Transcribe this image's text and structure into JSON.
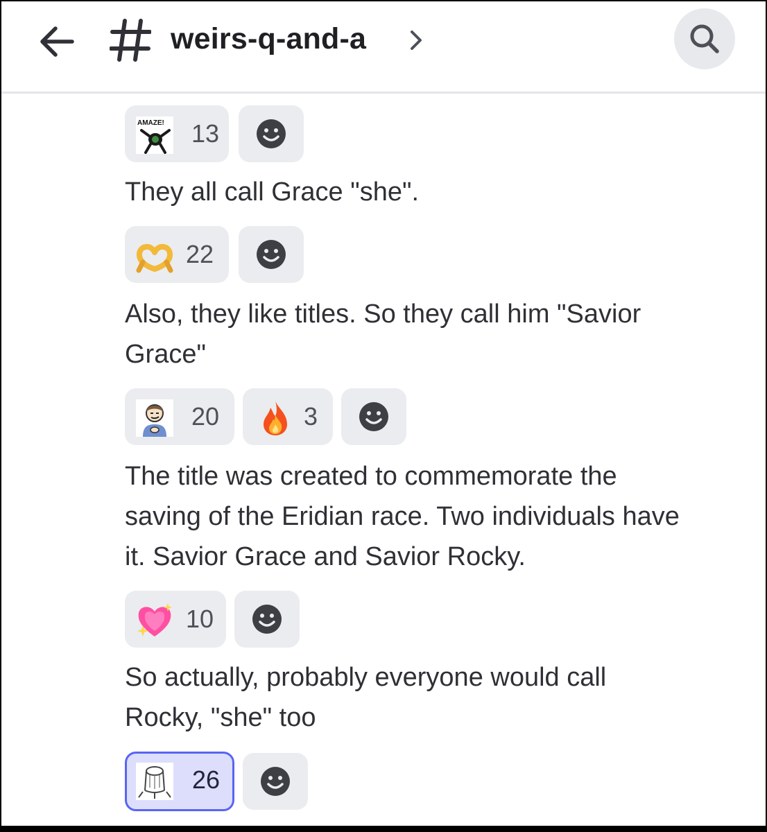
{
  "header": {
    "channel_name": "weirs-q-and-a"
  },
  "messages": [
    {
      "text": "They all call Grace \"she\".",
      "reactions": [
        {
          "emoji": "amaze-custom-emoji",
          "label": "AMAZE!",
          "count": "13",
          "selected": false
        }
      ]
    },
    {
      "text": "Also, they like titles. So they call him \"Savior\nGrace\"",
      "reactions": [
        {
          "emoji": "heart-hands-emoji",
          "count": "22",
          "selected": false
        }
      ]
    },
    {
      "text": "The title was created to commemorate the\nsaving of the Eridian race. Two individuals have\nit. Savior Grace and Savior Rocky.",
      "reactions": [
        {
          "emoji": "smirk-person-custom-emoji",
          "count": "20",
          "selected": false
        },
        {
          "emoji": "fire-emoji",
          "count": "3",
          "selected": false
        }
      ]
    },
    {
      "text": "So actually, probably everyone would call\nRocky, \"she\" too",
      "reactions": [
        {
          "emoji": "sparkling-heart-emoji",
          "count": "10",
          "selected": false
        }
      ]
    },
    {
      "text": "",
      "reactions": [
        {
          "emoji": "stump-sketch-custom-emoji",
          "count": "26",
          "selected": true
        }
      ]
    }
  ],
  "colors": {
    "background": "#ffffff",
    "text": "#2e3035",
    "reaction_bg": "#ebecef",
    "reaction_selected_bg": "#dcdefc",
    "reaction_selected_border": "#5865f2",
    "icon_dark": "#3d3f45"
  }
}
